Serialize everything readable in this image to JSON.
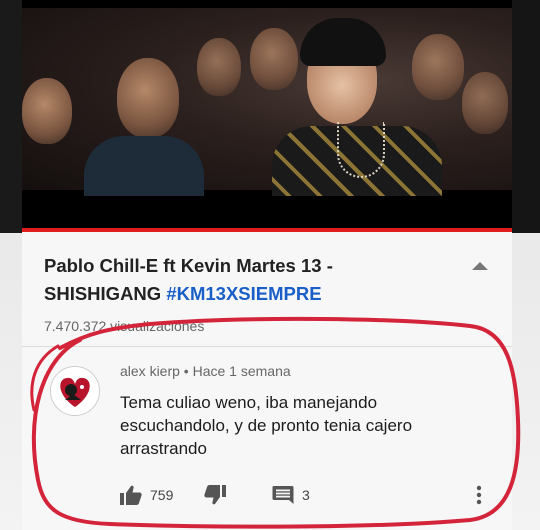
{
  "video": {
    "progress_percent": 100
  },
  "title": {
    "text": "Pablo Chill-E ft Kevin Martes 13 - SHISHIGANG ",
    "hashtag": "#KM13XSIEMPRE"
  },
  "views": {
    "text": "7.470.372 visualizaciones"
  },
  "comment": {
    "author": "alex kierp",
    "separator": " • ",
    "time": "Hace 1 semana",
    "text": "Tema culiao weno, iba manejando escuchandolo, y de pronto tenia cajero arrastrando",
    "likes": "759",
    "replies": "3"
  },
  "icons": {
    "like": "thumbs-up-icon",
    "dislike": "thumbs-down-icon",
    "reply": "reply-comment-icon",
    "more": "more-vertical-icon",
    "collapse": "chevron-up-icon",
    "avatar": "heart-avatar-icon"
  },
  "colors": {
    "accent_red": "#e01d1d",
    "hashtag_blue": "#1a5fc7",
    "annotation_red": "#d3243a"
  }
}
